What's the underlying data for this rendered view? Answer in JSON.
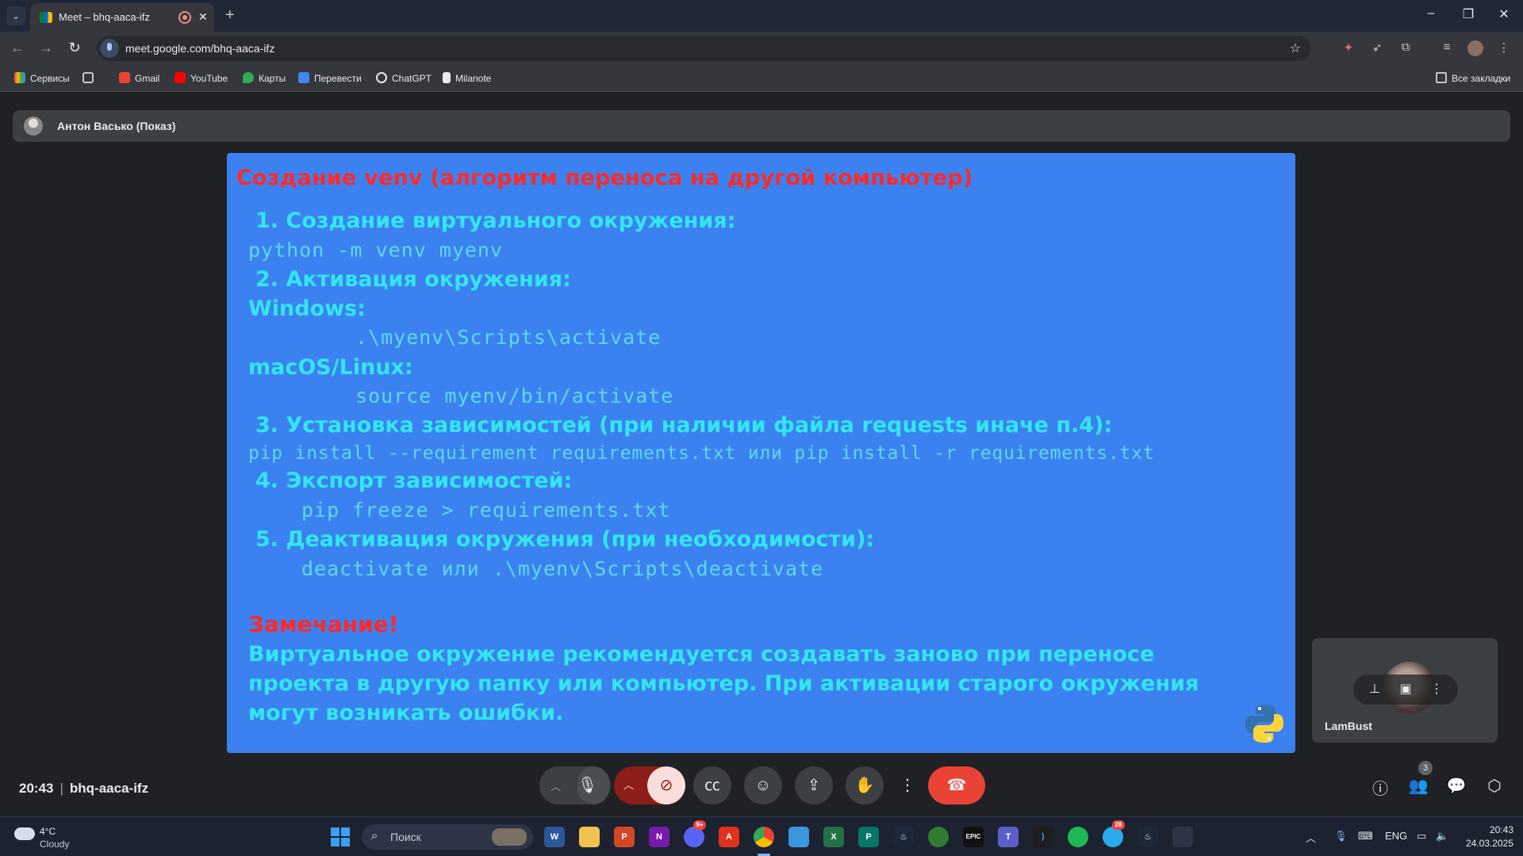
{
  "browser": {
    "tab_title": "Meet – bhq-aaca-ifz",
    "url": "meet.google.com/bhq-aaca-ifz",
    "bookmarks": [
      {
        "label": "Сервисы",
        "icon": "apps-grid-icon"
      },
      {
        "label": "",
        "icon": "grid-icon"
      },
      {
        "label": "Gmail",
        "icon": "gmail-icon"
      },
      {
        "label": "YouTube",
        "icon": "youtube-icon"
      },
      {
        "label": "Карты",
        "icon": "maps-icon"
      },
      {
        "label": "Перевести",
        "icon": "translate-icon"
      },
      {
        "label": "ChatGPT",
        "icon": "chatgpt-icon"
      },
      {
        "label": "Milanote",
        "icon": "milanote-icon"
      }
    ],
    "all_bookmarks_label": "Все закладки"
  },
  "meet": {
    "presenter_label": "Антон Васько (Показ)",
    "slide": {
      "heading": "Создание venv (алгоритм переноса на другой компьютер)",
      "step1": "1.   Создание виртуального окружения:",
      "code1": "python -m venv myenv",
      "step2": "2.   Активация окружения:",
      "windows_label": "Windows:",
      "code_windows": ".\\myenv\\Scripts\\activate",
      "mac_label": "macOS/Linux:",
      "code_mac": "source myenv/bin/activate",
      "step3": "3.   Установка зависимостей (при наличии файла requests иначе п.4):",
      "code3": "pip install --requirement requirements.txt или pip install -r requirements.txt",
      "step4": "4.   Экспорт зависимостей:",
      "code4": "pip freeze > requirements.txt",
      "step5": "5.   Деактивация окружения (при необходимости):",
      "code5": "deactivate или .\\myenv\\Scripts\\deactivate",
      "note_title": "Замечание!",
      "note_body": "Виртуальное окружение рекомендуется создавать заново при переносе проекта в другую папку или компьютер. При активации старого окружения могут возникать ошибки."
    },
    "self_tile_name": "LamBust",
    "time": "20:43",
    "meeting_code": "bhq-aaca-ifz",
    "participants_count": "3"
  },
  "taskbar": {
    "weather_temp": "4°C",
    "weather_desc": "Cloudy",
    "search_placeholder": "Поиск",
    "lang": "ENG",
    "clock_time": "20:43",
    "clock_date": "24.03.2025",
    "discord_badge": "9+",
    "telegram_badge": "28"
  },
  "colors": {
    "slide_bg": "#3b82f0",
    "slide_heading": "#ff2a2a",
    "slide_text": "#34e6f2",
    "end_call": "#ea4335"
  }
}
